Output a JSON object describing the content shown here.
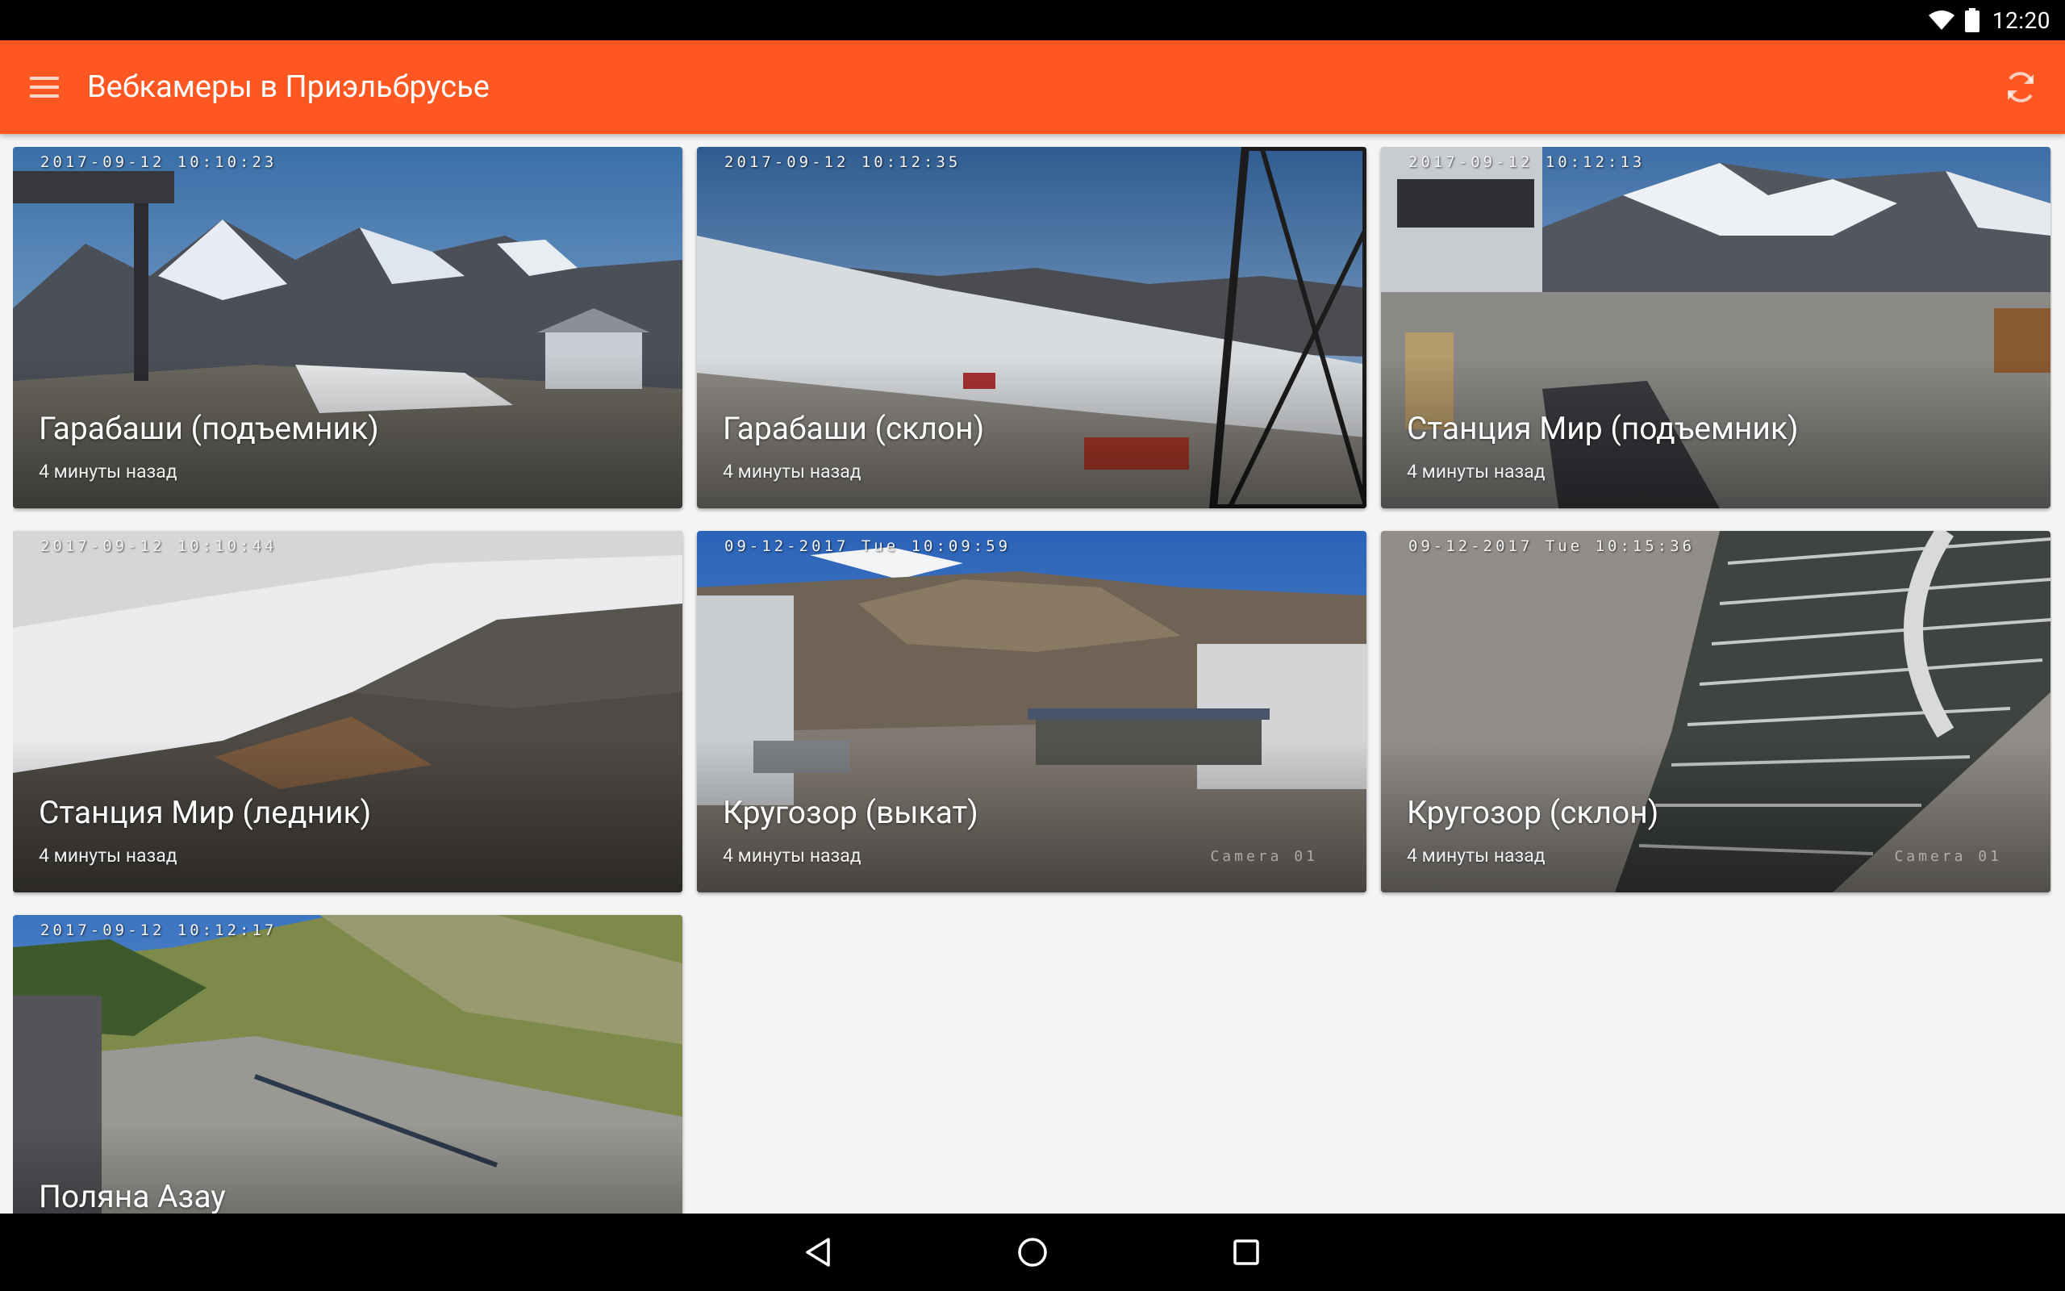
{
  "status_bar": {
    "time": "12:20",
    "icons": [
      "wifi-icon",
      "battery-icon"
    ]
  },
  "app_bar": {
    "title": "Вебкамеры в Приэльбрусье",
    "menu_icon": "menu-icon",
    "refresh_icon": "refresh-icon",
    "color": "#ff5722"
  },
  "cameras": [
    {
      "name": "Гарабаши (подъемник)",
      "updated": "4 минуты назад",
      "timestamp": "2017-09-12 10:10:23",
      "overlay": ""
    },
    {
      "name": "Гарабаши (склон)",
      "updated": "4 минуты назад",
      "timestamp": "2017-09-12 10:12:35",
      "overlay": ""
    },
    {
      "name": "Станция Мир (подъемник)",
      "updated": "4 минуты назад",
      "timestamp": "2017-09-12 10:12:13",
      "overlay": ""
    },
    {
      "name": "Станция Мир (ледник)",
      "updated": "4 минуты назад",
      "timestamp": "2017-09-12 10:10:44",
      "overlay": ""
    },
    {
      "name": "Кругозор (выкат)",
      "updated": "4 минуты назад",
      "timestamp": "09-12-2017 Tue 10:09:59",
      "overlay": "Camera 01"
    },
    {
      "name": "Кругозор (склон)",
      "updated": "4 минуты назад",
      "timestamp": "09-12-2017 Tue 10:15:36",
      "overlay": "Camera 01"
    },
    {
      "name": "Поляна Азау",
      "updated": "",
      "timestamp": "2017-09-12 10:12:17",
      "overlay": ""
    }
  ],
  "nav_bar": {
    "buttons": [
      "back-icon",
      "home-icon",
      "recents-icon"
    ]
  }
}
